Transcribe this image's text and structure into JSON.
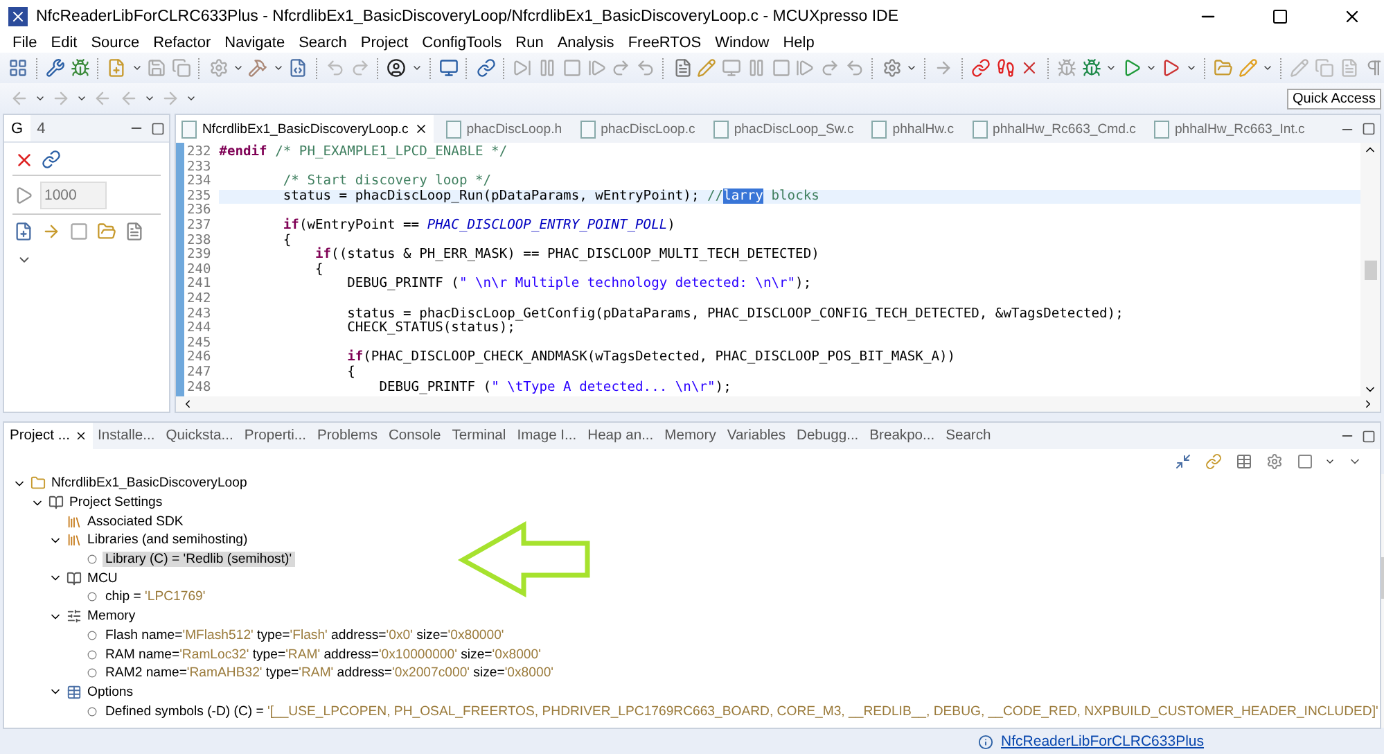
{
  "window": {
    "title": "NfcReaderLibForCLRC633Plus - NfcrdlibEx1_BasicDiscoveryLoop/NfcrdlibEx1_BasicDiscoveryLoop.c - MCUXpresso IDE"
  },
  "menu": [
    "File",
    "Edit",
    "Source",
    "Refactor",
    "Navigate",
    "Search",
    "Project",
    "ConfigTools",
    "Run",
    "Analysis",
    "FreeRTOS",
    "Window",
    "Help"
  ],
  "quick_access": "Quick Access",
  "left_panel": {
    "tabs": [
      {
        "label": "G",
        "selected": true
      },
      {
        "label": "4",
        "selected": false
      }
    ],
    "spinner": {
      "value": "1000",
      "disabled": true
    }
  },
  "editor": {
    "tabs": [
      {
        "label": "NfcrdlibEx1_BasicDiscoveryLoop.c",
        "selected": true
      },
      {
        "label": "phacDiscLoop.h",
        "selected": false
      },
      {
        "label": "phacDiscLoop.c",
        "selected": false
      },
      {
        "label": "phacDiscLoop_Sw.c",
        "selected": false
      },
      {
        "label": "phhalHw.c",
        "selected": false
      },
      {
        "label": "phhalHw_Rc663_Cmd.c",
        "selected": false
      },
      {
        "label": "phhalHw_Rc663_Int.c",
        "selected": false
      }
    ],
    "lines": [
      {
        "number": "232",
        "current": false,
        "tokens": [
          {
            "kind": "keyword",
            "text": "#endif"
          },
          {
            "kind": "comment",
            "text": " /* PH_EXAMPLE1_LPCD_ENABLE */"
          }
        ]
      },
      {
        "number": "233",
        "current": false
      },
      {
        "number": "234",
        "current": false,
        "tokens": [
          {
            "kind": "comment",
            "text": "        /* Start discovery loop */"
          }
        ]
      },
      {
        "number": "235",
        "current": true,
        "tokens": [
          {
            "kind": "plain",
            "text": "        status = phacDiscLoop_Run(pDataParams, wEntryPoint); "
          },
          {
            "kind": "comment",
            "text": "//"
          },
          {
            "kind": "selection",
            "text": "larry"
          },
          {
            "kind": "comment",
            "text": " blocks"
          }
        ]
      },
      {
        "number": "236",
        "current": false
      },
      {
        "number": "237",
        "current": false,
        "tokens": [
          {
            "kind": "keyword",
            "text": "        if"
          },
          {
            "kind": "plain",
            "text": "(wEntryPoint == "
          },
          {
            "kind": "macro",
            "text": "PHAC_DISCLOOP_ENTRY_POINT_POLL"
          },
          {
            "kind": "plain",
            "text": ")"
          }
        ]
      },
      {
        "number": "238",
        "current": false,
        "tokens": [
          {
            "kind": "plain",
            "text": "        {"
          }
        ]
      },
      {
        "number": "239",
        "current": false,
        "tokens": [
          {
            "kind": "keyword",
            "text": "            if"
          },
          {
            "kind": "plain",
            "text": "((status & PH_ERR_MASK) == PHAC_DISCLOOP_MULTI_TECH_DETECTED)"
          }
        ]
      },
      {
        "number": "240",
        "current": false,
        "tokens": [
          {
            "kind": "plain",
            "text": "            {"
          }
        ]
      },
      {
        "number": "241",
        "current": false,
        "tokens": [
          {
            "kind": "plain",
            "text": "                DEBUG_PRINTF ("
          },
          {
            "kind": "string",
            "text": "\" \\n\\r Multiple technology detected: \\n\\r\""
          },
          {
            "kind": "plain",
            "text": ");"
          }
        ]
      },
      {
        "number": "242",
        "current": false
      },
      {
        "number": "243",
        "current": false,
        "tokens": [
          {
            "kind": "plain",
            "text": "                status = phacDiscLoop_GetConfig(pDataParams, PHAC_DISCLOOP_CONFIG_TECH_DETECTED, &wTagsDetected);"
          }
        ]
      },
      {
        "number": "244",
        "current": false,
        "tokens": [
          {
            "kind": "plain",
            "text": "                CHECK_STATUS(status);"
          }
        ]
      },
      {
        "number": "245",
        "current": false
      },
      {
        "number": "246",
        "current": false,
        "tokens": [
          {
            "kind": "keyword",
            "text": "                if"
          },
          {
            "kind": "plain",
            "text": "(PHAC_DISCLOOP_CHECK_ANDMASK(wTagsDetected, PHAC_DISCLOOP_POS_BIT_MASK_A))"
          }
        ]
      },
      {
        "number": "247",
        "current": false,
        "tokens": [
          {
            "kind": "plain",
            "text": "                {"
          }
        ]
      },
      {
        "number": "248",
        "current": false,
        "tokens": [
          {
            "kind": "plain",
            "text": "                    DEBUG_PRINTF ("
          },
          {
            "kind": "string",
            "text": "\" \\tType A detected... \\n\\r\""
          },
          {
            "kind": "plain",
            "text": ");"
          }
        ]
      }
    ]
  },
  "bottom_panel": {
    "tabs": [
      {
        "label": "Project ...",
        "selected": true
      },
      {
        "label": "Installe...",
        "selected": false
      },
      {
        "label": "Quicksta...",
        "selected": false
      },
      {
        "label": "Properti...",
        "selected": false
      },
      {
        "label": "Problems",
        "selected": false
      },
      {
        "label": "Console",
        "selected": false
      },
      {
        "label": "Terminal",
        "selected": false
      },
      {
        "label": "Image I...",
        "selected": false
      },
      {
        "label": "Heap an...",
        "selected": false
      },
      {
        "label": "Memory",
        "selected": false
      },
      {
        "label": "Variables",
        "selected": false
      },
      {
        "label": "Debugg...",
        "selected": false
      },
      {
        "label": "Breakpo...",
        "selected": false
      },
      {
        "label": "Search",
        "selected": false
      }
    ],
    "tree": [
      {
        "kind": "project",
        "expanded": true,
        "selected": false,
        "label": "NfcrdlibEx1_BasicDiscoveryLoop",
        "children": [
          {
            "kind": "settings",
            "expanded": true,
            "selected": false,
            "label": "Project Settings",
            "children": [
              {
                "kind": "library",
                "selected": false,
                "label": "Associated SDK"
              },
              {
                "kind": "library",
                "expanded": true,
                "selected": false,
                "label": "Libraries (and semihosting)",
                "children": [
                  {
                    "kind": "entry",
                    "selected": true,
                    "label": "Library (C) = 'Redlib (semihost)'"
                  }
                ]
              },
              {
                "kind": "settings",
                "expanded": true,
                "selected": false,
                "label": "MCU",
                "children": [
                  {
                    "kind": "entry",
                    "selected": false,
                    "parts": [
                      {
                        "kind": "key",
                        "text": "chip = "
                      },
                      {
                        "kind": "value",
                        "text": "'LPC1769'"
                      }
                    ]
                  }
                ]
              },
              {
                "kind": "memory",
                "expanded": true,
                "selected": false,
                "label": "Memory",
                "children": [
                  {
                    "kind": "entry",
                    "selected": false,
                    "parts": [
                      {
                        "kind": "key",
                        "text": "Flash name="
                      },
                      {
                        "kind": "value",
                        "text": "'MFlash512'"
                      },
                      {
                        "kind": "key",
                        "text": " type="
                      },
                      {
                        "kind": "value",
                        "text": "'Flash'"
                      },
                      {
                        "kind": "key",
                        "text": " address="
                      },
                      {
                        "kind": "value",
                        "text": "'0x0'"
                      },
                      {
                        "kind": "key",
                        "text": " size="
                      },
                      {
                        "kind": "value",
                        "text": "'0x80000'"
                      }
                    ]
                  },
                  {
                    "kind": "entry",
                    "selected": false,
                    "parts": [
                      {
                        "kind": "key",
                        "text": "RAM name="
                      },
                      {
                        "kind": "value",
                        "text": "'RamLoc32'"
                      },
                      {
                        "kind": "key",
                        "text": " type="
                      },
                      {
                        "kind": "value",
                        "text": "'RAM'"
                      },
                      {
                        "kind": "key",
                        "text": " address="
                      },
                      {
                        "kind": "value",
                        "text": "'0x10000000'"
                      },
                      {
                        "kind": "key",
                        "text": " size="
                      },
                      {
                        "kind": "value",
                        "text": "'0x8000'"
                      }
                    ]
                  },
                  {
                    "kind": "entry",
                    "selected": false,
                    "parts": [
                      {
                        "kind": "key",
                        "text": "RAM2 name="
                      },
                      {
                        "kind": "value",
                        "text": "'RamAHB32'"
                      },
                      {
                        "kind": "key",
                        "text": " type="
                      },
                      {
                        "kind": "value",
                        "text": "'RAM'"
                      },
                      {
                        "kind": "key",
                        "text": " address="
                      },
                      {
                        "kind": "value",
                        "text": "'0x2007c000'"
                      },
                      {
                        "kind": "key",
                        "text": " size="
                      },
                      {
                        "kind": "value",
                        "text": "'0x8000'"
                      }
                    ]
                  }
                ]
              },
              {
                "kind": "options",
                "expanded": true,
                "selected": false,
                "label": "Options",
                "children": [
                  {
                    "kind": "entry",
                    "selected": false,
                    "parts": [
                      {
                        "kind": "key",
                        "text": "Defined symbols (-D) (C) = "
                      },
                      {
                        "kind": "value",
                        "text": "'[__USE_LPCOPEN, PH_OSAL_FREERTOS, PHDRIVER_LPC1769RC663_BOARD, CORE_M3, __REDLIB__, DEBUG, __CODE_RED, NXPBUILD_CUSTOMER_HEADER_INCLUDED]'"
                      }
                    ]
                  }
                ]
              }
            ]
          }
        ]
      }
    ]
  },
  "status_bar": {
    "project": "NfcReaderLibForCLRC633Plus"
  }
}
